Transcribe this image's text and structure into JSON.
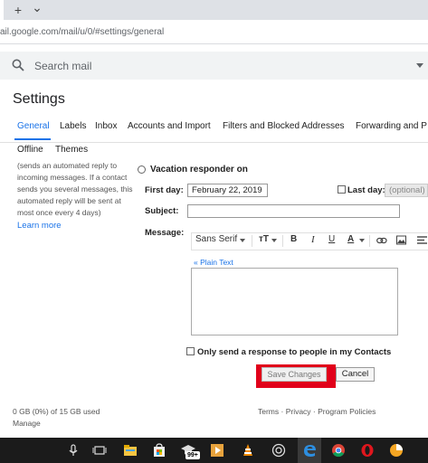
{
  "browser": {
    "new_tab": "+",
    "tab_menu": "⌄",
    "url": "ail.google.com/mail/u/0/#settings/general"
  },
  "search": {
    "placeholder": "Search mail"
  },
  "settings": {
    "title": "Settings",
    "tabs": [
      "General",
      "Labels",
      "Inbox",
      "Accounts and Import",
      "Filters and Blocked Addresses",
      "Forwarding and P"
    ],
    "tabs_row2": [
      "Offline",
      "Themes"
    ],
    "active_tab": "General"
  },
  "vacation": {
    "description": [
      "(sends an automated reply to",
      "incoming messages. If a contact",
      "sends you several messages, this",
      "automated reply will be sent at",
      "most once every 4 days)"
    ],
    "learn_more": "Learn more",
    "radio_label": "Vacation responder on",
    "first_day_label": "First day:",
    "first_day_value": "February 22, 2019",
    "last_day_label": "Last day:",
    "last_day_placeholder": "(optional)",
    "subject_label": "Subject:",
    "message_label": "Message:",
    "font": "Sans Serif",
    "plain_text_link": "« Plain Text",
    "contacts_only_label": "Only send a response to people in my Contacts"
  },
  "buttons": {
    "save": "Save Changes",
    "cancel": "Cancel"
  },
  "highlight_color": "#e1001a",
  "footer": {
    "storage": "0 GB (0%) of 15 GB used",
    "manage": "Manage",
    "links": "Terms · Privacy · Program Policies"
  },
  "taskbar": {
    "icons": [
      "microphone-icon",
      "task-view-icon",
      "file-explorer-icon",
      "store-icon",
      "graduation-cap-icon",
      "media-player-icon",
      "vlc-icon",
      "camera-icon",
      "edge-icon",
      "chrome-icon",
      "opera-icon",
      "pie-chart-icon"
    ],
    "badge": "99+"
  }
}
